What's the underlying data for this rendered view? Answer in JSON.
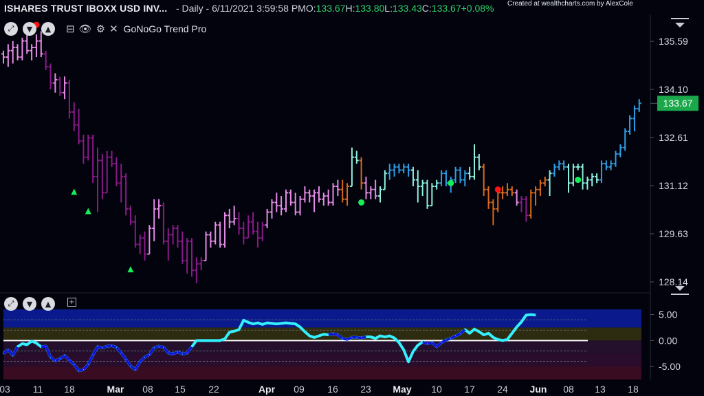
{
  "header": {
    "symbol": "ISHARES TRUST IBOXX USD INV...",
    "period": " - Daily - 6/11/2021 3:59:58 PM ",
    "o_label": "O:",
    "o": "133.67",
    "h_label": " H:",
    "h": "133.80",
    "l_label": " L:",
    "l": "133.43",
    "c_label": " C:",
    "c": "133.67",
    "change": " +0.08%",
    "credit": "Created at wealthcharts.com by AlexCole"
  },
  "indicator_label": "GoNoGo Trend Pro",
  "icons": {
    "expand": "expand-icon",
    "down": "chevron-down-icon",
    "up": "chevron-up-icon",
    "collapse": "minimize-icon",
    "eye": "eye-icon",
    "gear": "gear-icon",
    "close": "close-icon",
    "add": "add-panel-icon",
    "menu": "menu-icon"
  },
  "colors": {
    "background": "#02030c",
    "nogo_strong": "#8a1a8a",
    "nogo_weak": "#e58ce6",
    "neutral": "#d96a1c",
    "go_weak": "#8ff0e0",
    "go_strong": "#2f9fe6",
    "last_price_tag": "#1aa84b",
    "osc_line": "#34f0ff",
    "osc_line_low": "#1010d8",
    "zero_line": "#ffffff"
  },
  "chart_data": [
    {
      "type": "ohlc",
      "title": "",
      "x_tick_labels": [
        "03",
        "11",
        "18",
        "Mar",
        "08",
        "15",
        "22",
        "Apr",
        "09",
        "16",
        "23",
        "May",
        "10",
        "17",
        "24",
        "Jun",
        "08",
        "13",
        "18"
      ],
      "y_tick_labels": [
        "135.59",
        "134.10",
        "132.61",
        "131.12",
        "129.63",
        "128.14"
      ],
      "ylim": [
        127.8,
        136.4
      ],
      "last_price": 133.67,
      "last_price_label": "133.67",
      "bars": [
        [
          135.2,
          135.3,
          134.9,
          135.1,
          "nogo_weak"
        ],
        [
          135.1,
          135.5,
          134.8,
          135.3,
          "nogo_weak"
        ],
        [
          135.3,
          135.6,
          134.9,
          135.4,
          "nogo_weak"
        ],
        [
          135.4,
          135.5,
          135.0,
          135.1,
          "nogo_weak"
        ],
        [
          135.1,
          135.7,
          135.0,
          135.6,
          "nogo_weak"
        ],
        [
          135.6,
          135.8,
          135.2,
          135.3,
          "nogo_weak"
        ],
        [
          135.3,
          135.5,
          135.0,
          135.4,
          "nogo_weak"
        ],
        [
          135.4,
          135.8,
          135.1,
          135.6,
          "nogo_weak"
        ],
        [
          135.6,
          135.9,
          135.1,
          135.2,
          "nogo_weak"
        ],
        [
          135.2,
          135.3,
          134.7,
          134.8,
          "nogo_strong"
        ],
        [
          134.8,
          134.9,
          134.1,
          134.3,
          "nogo_strong"
        ],
        [
          134.3,
          134.6,
          134.0,
          134.4,
          "nogo_weak"
        ],
        [
          134.4,
          134.5,
          133.9,
          134.0,
          "nogo_strong"
        ],
        [
          134.0,
          134.5,
          133.8,
          134.3,
          "nogo_weak"
        ],
        [
          134.3,
          134.4,
          133.2,
          133.4,
          "nogo_strong"
        ],
        [
          133.4,
          133.7,
          132.8,
          133.0,
          "nogo_strong"
        ],
        [
          133.0,
          133.5,
          132.4,
          132.5,
          "nogo_strong"
        ],
        [
          132.5,
          132.7,
          131.8,
          132.0,
          "nogo_strong"
        ],
        [
          132.0,
          132.7,
          131.9,
          132.6,
          "nogo_strong"
        ],
        [
          132.6,
          132.7,
          131.2,
          131.4,
          "nogo_strong"
        ],
        [
          131.4,
          132.3,
          130.3,
          131.9,
          "nogo_strong"
        ],
        [
          131.9,
          132.1,
          130.7,
          130.9,
          "nogo_strong"
        ],
        [
          130.9,
          132.2,
          130.9,
          132.0,
          "nogo_strong"
        ],
        [
          132.0,
          132.2,
          131.7,
          131.8,
          "nogo_strong"
        ],
        [
          131.8,
          132.0,
          131.1,
          131.2,
          "nogo_strong"
        ],
        [
          131.2,
          131.8,
          130.6,
          131.4,
          "nogo_strong"
        ],
        [
          131.4,
          131.5,
          130.2,
          130.4,
          "nogo_strong"
        ],
        [
          130.4,
          130.5,
          129.9,
          130.0,
          "nogo_strong"
        ],
        [
          130.0,
          130.2,
          129.2,
          129.3,
          "nogo_strong"
        ],
        [
          129.3,
          129.6,
          129.0,
          129.5,
          "nogo_strong"
        ],
        [
          129.5,
          129.7,
          128.8,
          129.0,
          "nogo_strong"
        ],
        [
          129.0,
          129.9,
          129.0,
          129.8,
          "nogo_weak"
        ],
        [
          129.8,
          130.7,
          129.4,
          130.4,
          "nogo_weak"
        ],
        [
          130.4,
          130.7,
          130.1,
          130.5,
          "nogo_weak"
        ],
        [
          130.5,
          130.6,
          129.3,
          129.4,
          "nogo_strong"
        ],
        [
          129.4,
          129.8,
          128.8,
          129.6,
          "nogo_strong"
        ],
        [
          129.6,
          129.9,
          129.3,
          129.8,
          "nogo_strong"
        ],
        [
          129.8,
          129.9,
          129.2,
          129.4,
          "nogo_strong"
        ],
        [
          129.4,
          129.7,
          128.7,
          128.8,
          "nogo_strong"
        ],
        [
          128.8,
          129.5,
          128.4,
          129.4,
          "nogo_strong"
        ],
        [
          129.4,
          129.5,
          128.3,
          128.5,
          "nogo_strong"
        ],
        [
          128.5,
          128.9,
          128.1,
          128.7,
          "nogo_strong"
        ],
        [
          128.7,
          128.9,
          128.5,
          128.8,
          "nogo_strong"
        ],
        [
          128.8,
          129.7,
          128.8,
          129.6,
          "nogo_weak"
        ],
        [
          129.6,
          129.7,
          129.2,
          129.4,
          "nogo_weak"
        ],
        [
          129.4,
          130.0,
          129.3,
          129.9,
          "nogo_weak"
        ],
        [
          129.9,
          130.0,
          129.2,
          129.3,
          "nogo_weak"
        ],
        [
          129.3,
          130.3,
          129.2,
          130.2,
          "nogo_weak"
        ],
        [
          130.2,
          130.4,
          129.8,
          130.0,
          "nogo_weak"
        ],
        [
          130.0,
          130.5,
          129.9,
          130.1,
          "nogo_weak"
        ],
        [
          130.1,
          130.3,
          129.6,
          129.8,
          "nogo_strong"
        ],
        [
          129.8,
          130.0,
          129.3,
          129.5,
          "nogo_strong"
        ],
        [
          129.5,
          130.2,
          129.5,
          130.0,
          "nogo_strong"
        ],
        [
          130.0,
          130.3,
          129.6,
          129.7,
          "nogo_strong"
        ],
        [
          129.7,
          130.0,
          129.2,
          129.5,
          "nogo_strong"
        ],
        [
          129.5,
          130.0,
          129.4,
          129.9,
          "nogo_strong"
        ],
        [
          129.9,
          130.4,
          129.8,
          130.3,
          "nogo_weak"
        ],
        [
          130.3,
          130.7,
          130.1,
          130.6,
          "nogo_weak"
        ],
        [
          130.6,
          130.9,
          130.3,
          130.5,
          "nogo_weak"
        ],
        [
          130.5,
          130.8,
          130.2,
          130.4,
          "nogo_weak"
        ],
        [
          130.4,
          131.0,
          130.3,
          130.9,
          "nogo_weak"
        ],
        [
          130.9,
          131.0,
          130.5,
          130.6,
          "nogo_weak"
        ],
        [
          130.6,
          130.9,
          130.2,
          130.3,
          "nogo_weak"
        ],
        [
          130.3,
          130.8,
          130.2,
          130.7,
          "nogo_weak"
        ],
        [
          130.7,
          131.1,
          130.6,
          130.9,
          "nogo_weak"
        ],
        [
          130.9,
          131.0,
          130.6,
          130.8,
          "nogo_weak"
        ],
        [
          130.8,
          131.0,
          130.3,
          130.9,
          "nogo_weak"
        ],
        [
          130.9,
          131.1,
          130.6,
          130.7,
          "nogo_weak"
        ],
        [
          130.7,
          130.9,
          130.5,
          130.8,
          "nogo_weak"
        ],
        [
          130.8,
          131.0,
          130.5,
          130.6,
          "nogo_weak"
        ],
        [
          130.6,
          131.2,
          130.5,
          131.1,
          "nogo_weak"
        ],
        [
          131.1,
          131.3,
          130.8,
          131.0,
          "nogo_weak"
        ],
        [
          131.0,
          131.3,
          130.6,
          130.7,
          "neutral"
        ],
        [
          130.7,
          131.2,
          130.5,
          131.1,
          "neutral"
        ],
        [
          131.1,
          132.3,
          131.1,
          132.0,
          "go_weak"
        ],
        [
          132.0,
          132.2,
          131.8,
          131.9,
          "go_weak"
        ],
        [
          131.9,
          132.0,
          131.0,
          131.2,
          "neutral"
        ],
        [
          131.2,
          131.4,
          130.7,
          130.9,
          "nogo_weak"
        ],
        [
          130.9,
          131.1,
          130.7,
          131.0,
          "nogo_weak"
        ],
        [
          131.0,
          131.3,
          130.7,
          130.8,
          "nogo_weak"
        ],
        [
          130.8,
          131.1,
          130.6,
          131.0,
          "go_weak"
        ],
        [
          131.0,
          131.6,
          131.0,
          131.5,
          "go_weak"
        ],
        [
          131.5,
          131.8,
          131.3,
          131.6,
          "go_strong"
        ],
        [
          131.6,
          131.8,
          131.4,
          131.7,
          "go_strong"
        ],
        [
          131.7,
          131.8,
          131.5,
          131.6,
          "go_strong"
        ],
        [
          131.6,
          131.8,
          131.5,
          131.7,
          "go_strong"
        ],
        [
          131.7,
          131.8,
          131.4,
          131.6,
          "go_strong"
        ],
        [
          131.6,
          131.7,
          131.1,
          131.3,
          "go_weak"
        ],
        [
          131.3,
          131.6,
          130.6,
          131.1,
          "go_weak"
        ],
        [
          131.1,
          131.3,
          130.8,
          131.2,
          "go_weak"
        ],
        [
          131.2,
          131.3,
          130.4,
          130.5,
          "go_weak"
        ],
        [
          130.5,
          131.2,
          130.5,
          131.1,
          "go_weak"
        ],
        [
          131.1,
          131.3,
          131.0,
          131.2,
          "go_weak"
        ],
        [
          131.2,
          131.6,
          131.1,
          131.5,
          "go_strong"
        ],
        [
          131.5,
          131.6,
          131.1,
          131.2,
          "go_strong"
        ],
        [
          131.2,
          131.4,
          130.9,
          131.3,
          "go_strong"
        ],
        [
          131.3,
          131.7,
          131.2,
          131.6,
          "go_strong"
        ],
        [
          131.6,
          131.7,
          131.2,
          131.3,
          "go_strong"
        ],
        [
          131.3,
          131.6,
          131.1,
          131.5,
          "go_strong"
        ],
        [
          131.5,
          131.7,
          131.3,
          131.4,
          "go_weak"
        ],
        [
          131.4,
          132.4,
          131.3,
          132.0,
          "go_weak"
        ],
        [
          132.0,
          132.1,
          131.6,
          131.7,
          "go_weak"
        ],
        [
          131.7,
          131.8,
          130.8,
          131.0,
          "neutral"
        ],
        [
          131.0,
          131.1,
          130.4,
          130.6,
          "neutral"
        ],
        [
          130.6,
          130.7,
          129.9,
          130.4,
          "neutral"
        ],
        [
          130.4,
          131.0,
          130.3,
          130.9,
          "neutral"
        ],
        [
          130.9,
          131.1,
          130.7,
          130.9,
          "neutral"
        ],
        [
          130.9,
          131.2,
          130.8,
          131.0,
          "neutral"
        ],
        [
          131.0,
          131.1,
          130.8,
          130.9,
          "neutral"
        ],
        [
          130.9,
          131.0,
          130.5,
          130.6,
          "nogo_weak"
        ],
        [
          130.6,
          130.8,
          130.3,
          130.7,
          "nogo_strong"
        ],
        [
          130.7,
          130.8,
          130.0,
          130.2,
          "nogo_strong"
        ],
        [
          130.2,
          131.0,
          130.1,
          130.9,
          "neutral"
        ],
        [
          130.9,
          131.1,
          130.5,
          131.0,
          "neutral"
        ],
        [
          131.0,
          131.3,
          130.8,
          131.2,
          "neutral"
        ],
        [
          131.2,
          131.4,
          131.1,
          131.3,
          "neutral"
        ],
        [
          131.3,
          131.6,
          130.8,
          131.5,
          "go_weak"
        ],
        [
          131.5,
          131.8,
          131.4,
          131.7,
          "go_strong"
        ],
        [
          131.7,
          131.9,
          131.6,
          131.8,
          "go_strong"
        ],
        [
          131.8,
          131.9,
          131.6,
          131.7,
          "go_strong"
        ],
        [
          131.7,
          131.8,
          130.9,
          131.2,
          "go_weak"
        ],
        [
          131.2,
          131.8,
          131.1,
          131.7,
          "go_weak"
        ],
        [
          131.7,
          131.8,
          131.6,
          131.7,
          "go_weak"
        ],
        [
          131.7,
          131.8,
          131.0,
          131.2,
          "go_weak"
        ],
        [
          131.2,
          131.4,
          131.0,
          131.3,
          "go_weak"
        ],
        [
          131.3,
          131.5,
          131.1,
          131.4,
          "go_weak"
        ],
        [
          131.4,
          131.5,
          131.2,
          131.3,
          "go_weak"
        ],
        [
          131.3,
          131.9,
          131.2,
          131.8,
          "go_strong"
        ],
        [
          131.8,
          131.9,
          131.6,
          131.7,
          "go_strong"
        ],
        [
          131.7,
          131.9,
          131.6,
          131.8,
          "go_strong"
        ],
        [
          131.8,
          132.2,
          131.7,
          132.1,
          "go_strong"
        ],
        [
          132.1,
          132.4,
          132.0,
          132.3,
          "go_strong"
        ],
        [
          132.3,
          132.9,
          132.2,
          132.8,
          "go_strong"
        ],
        [
          132.8,
          133.3,
          132.7,
          133.2,
          "go_strong"
        ],
        [
          133.2,
          133.6,
          132.8,
          133.5,
          "go_strong"
        ],
        [
          133.5,
          133.8,
          133.4,
          133.67,
          "go_strong"
        ]
      ],
      "markers": [
        {
          "x": 7,
          "price": 136.1,
          "shape": "dot",
          "color": "red"
        },
        {
          "x": 15,
          "price": 130.9,
          "shape": "triangle",
          "color": "green"
        },
        {
          "x": 18,
          "price": 130.3,
          "shape": "triangle",
          "color": "green"
        },
        {
          "x": 27,
          "price": 128.5,
          "shape": "triangle",
          "color": "green"
        },
        {
          "x": 76,
          "price": 130.6,
          "shape": "dot",
          "color": "green"
        },
        {
          "x": 95,
          "price": 131.2,
          "shape": "dot",
          "color": "green"
        },
        {
          "x": 105,
          "price": 131.0,
          "shape": "dot",
          "color": "red"
        },
        {
          "x": 122,
          "price": 131.3,
          "shape": "dot",
          "color": "green"
        }
      ]
    },
    {
      "type": "line",
      "title": "",
      "y_tick_labels": [
        "5.00",
        "0.00",
        "-5.00"
      ],
      "ylim": [
        -7.5,
        6.0
      ],
      "zero_line": 0,
      "values": [
        -2.5,
        -1.8,
        -2.8,
        -1.2,
        -0.6,
        -0.8,
        -0.1,
        -0.5,
        -1.2,
        -1.1,
        -3.2,
        -3.9,
        -3.5,
        -2.9,
        -3.8,
        -4.6,
        -5.8,
        -5.6,
        -4.6,
        -2.8,
        -1.2,
        -1.4,
        -1.1,
        -1.0,
        -1.3,
        -2.4,
        -3.6,
        -4.9,
        -5.6,
        -4.1,
        -3.2,
        -2.7,
        -1.4,
        -1.1,
        -1.3,
        -2.4,
        -2.6,
        -2.2,
        -2.6,
        -2.4,
        -1.2,
        0.0,
        0.0,
        0.0,
        0.0,
        0.0,
        0.0,
        0.3,
        1.6,
        1.8,
        2.1,
        3.9,
        3.5,
        3.2,
        3.4,
        3.1,
        3.4,
        3.3,
        3.2,
        3.3,
        3.4,
        3.3,
        3.2,
        2.6,
        1.7,
        0.9,
        0.6,
        0.9,
        1.2,
        1.1,
        1.3,
        1.1,
        0.4,
        0.2,
        0.6,
        0.6,
        0.5,
        0.7,
        0.7,
        0.4,
        0.9,
        0.7,
        0.9,
        0.5,
        -0.4,
        -1.8,
        -4.1,
        -2.1,
        -0.9,
        -0.3,
        -0.6,
        -0.4,
        -1.2,
        -0.4,
        0.1,
        0.4,
        0.9,
        1.3,
        2.1,
        1.4,
        2.2,
        1.7,
        1.1,
        1.4,
        0.6,
        0.2,
        0.0,
        0.2,
        1.4,
        2.6,
        3.6,
        4.9,
        5.0,
        4.9
      ],
      "low_segments": [
        [
          0,
          3
        ],
        [
          8,
          40
        ],
        [
          69,
          77
        ],
        [
          89,
          98
        ]
      ]
    }
  ]
}
